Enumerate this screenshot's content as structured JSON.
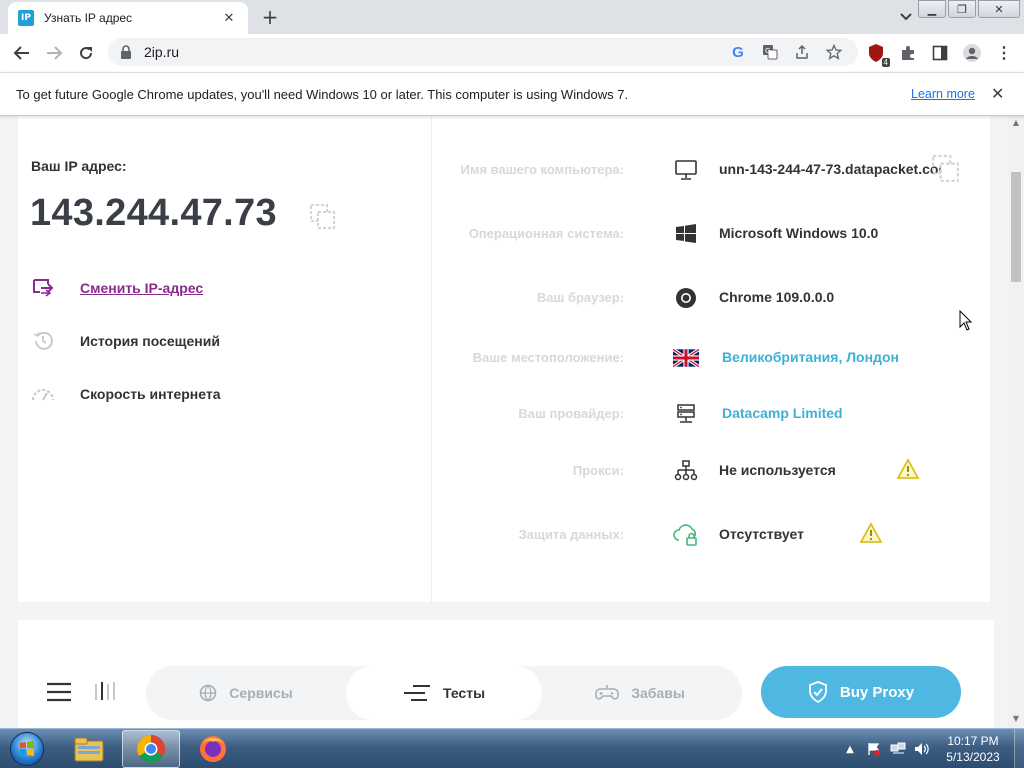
{
  "browser": {
    "tab_title": "Узнать IP адрес",
    "favicon_text": "IP",
    "url": "2ip.ru",
    "infobar_text": "To get future Google Chrome updates, you'll need Windows 10 or later. This computer is using Windows 7.",
    "learn_more": "Learn more",
    "extension_badge": "4"
  },
  "page": {
    "ip_label": "Ваш IP адрес:",
    "ip_value": "143.244.47.73",
    "menu": [
      {
        "label": "Сменить IP-адрес",
        "icon": "change-ip-icon"
      },
      {
        "label": "История посещений",
        "icon": "history-icon"
      },
      {
        "label": "Скорость интернета",
        "icon": "speed-icon"
      }
    ],
    "info_rows": [
      {
        "label": "Имя вашего компьютера:",
        "value": "unn-143-244-47-73.datapacket.com",
        "icon": "monitor-icon"
      },
      {
        "label": "Операционная система:",
        "value": "Microsoft Windows 10.0",
        "icon": "windows-icon"
      },
      {
        "label": "Ваш браузер:",
        "value": "Chrome 109.0.0.0",
        "icon": "chrome-icon"
      },
      {
        "label": "Ваше местоположение:",
        "value": "Великобритания, Лондон",
        "icon": "uk-flag-icon"
      },
      {
        "label": "Ваш провайдер:",
        "value": "Datacamp Limited",
        "icon": "server-icon"
      },
      {
        "label": "Прокси:",
        "value": "Не используется",
        "icon": "network-icon"
      },
      {
        "label": "Защита данных:",
        "value": "Отсутствует",
        "icon": "cloud-lock-icon"
      }
    ],
    "bottom_nav": {
      "services": "Сервисы",
      "tests": "Тесты",
      "games": "Забавы",
      "buy_proxy": "Buy Proxy"
    }
  },
  "taskbar": {
    "time": "10:17 PM",
    "date": "5/13/2023"
  },
  "colors": {
    "accent_blue": "#4fb8e2",
    "link_purple": "#8b2a8f",
    "warning_yellow": "#e8d33a"
  }
}
